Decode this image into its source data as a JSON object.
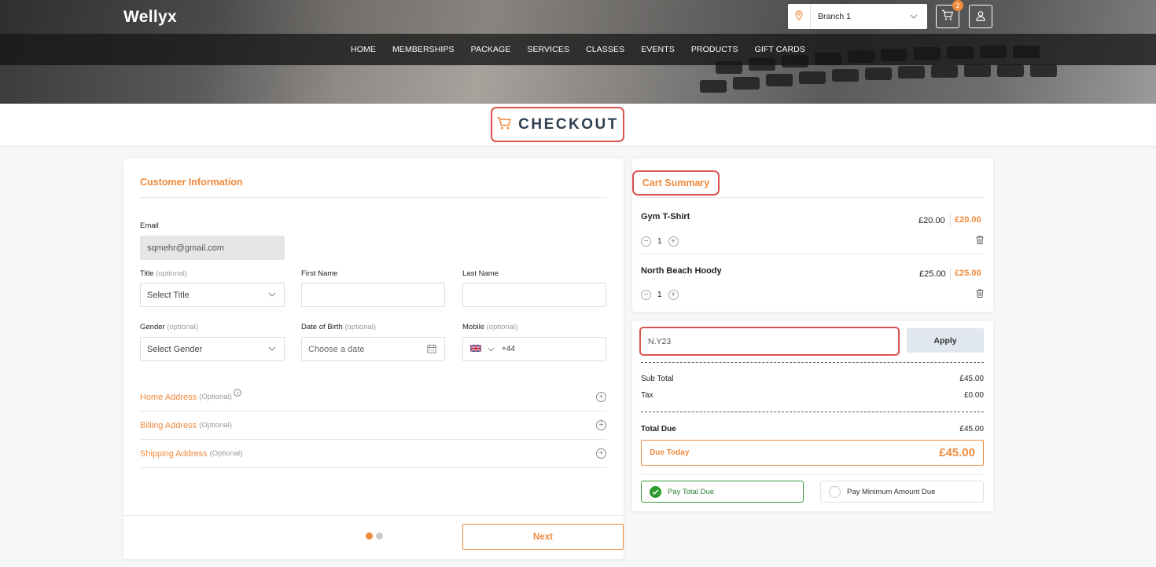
{
  "header": {
    "brand": "Wellyx",
    "branch": "Branch 1",
    "cart_count": "2",
    "nav": [
      "HOME",
      "MEMBERSHIPS",
      "PACKAGE",
      "SERVICES",
      "CLASSES",
      "EVENTS",
      "PRODUCTS",
      "GIFT CARDS"
    ]
  },
  "page_title": "CHECKOUT",
  "customer": {
    "section_title": "Customer Information",
    "email_label": "Email",
    "email_value": "sqmehr@gmail.com",
    "title_label": "Title",
    "title_opt": "(optional)",
    "title_value": "Select Title",
    "first_name_label": "First Name",
    "last_name_label": "Last Name",
    "gender_label": "Gender",
    "gender_opt": "(optional)",
    "gender_value": "Select Gender",
    "dob_label": "Date of Birth",
    "dob_opt": "(optional)",
    "dob_placeholder": "Choose a date",
    "mobile_label": "Mobile",
    "mobile_opt": "(optional)",
    "mobile_code": "+44",
    "home_address": "Home Address",
    "home_address_opt": "(Optional)",
    "billing_address": "Billing Address",
    "billing_address_opt": "(Optional)",
    "shipping_address": "Shipping Address",
    "shipping_address_opt": "(Optional)",
    "next_label": "Next"
  },
  "cart": {
    "title": "Cart Summary",
    "items": [
      {
        "name": "Gym T-Shirt",
        "price": "£20.00",
        "total": "£20.00",
        "qty": "1"
      },
      {
        "name": "North Beach Hoody",
        "price": "£25.00",
        "total": "£25.00",
        "qty": "1"
      }
    ]
  },
  "summary": {
    "promo_value": "N.Y23",
    "apply_label": "Apply",
    "subtotal_label": "Sub Total",
    "subtotal_value": "£45.00",
    "tax_label": "Tax",
    "tax_value": "£0.00",
    "total_due_label": "Total Due",
    "total_due_value": "£45.00",
    "due_today_label": "Due Today",
    "due_today_value": "£45.00",
    "pay_total_label": "Pay Total Due",
    "pay_min_label": "Pay Minimum Amount Due"
  },
  "colors": {
    "accent": "#f08a3c",
    "highlight": "#d9534f",
    "success": "#2e9b2e"
  }
}
